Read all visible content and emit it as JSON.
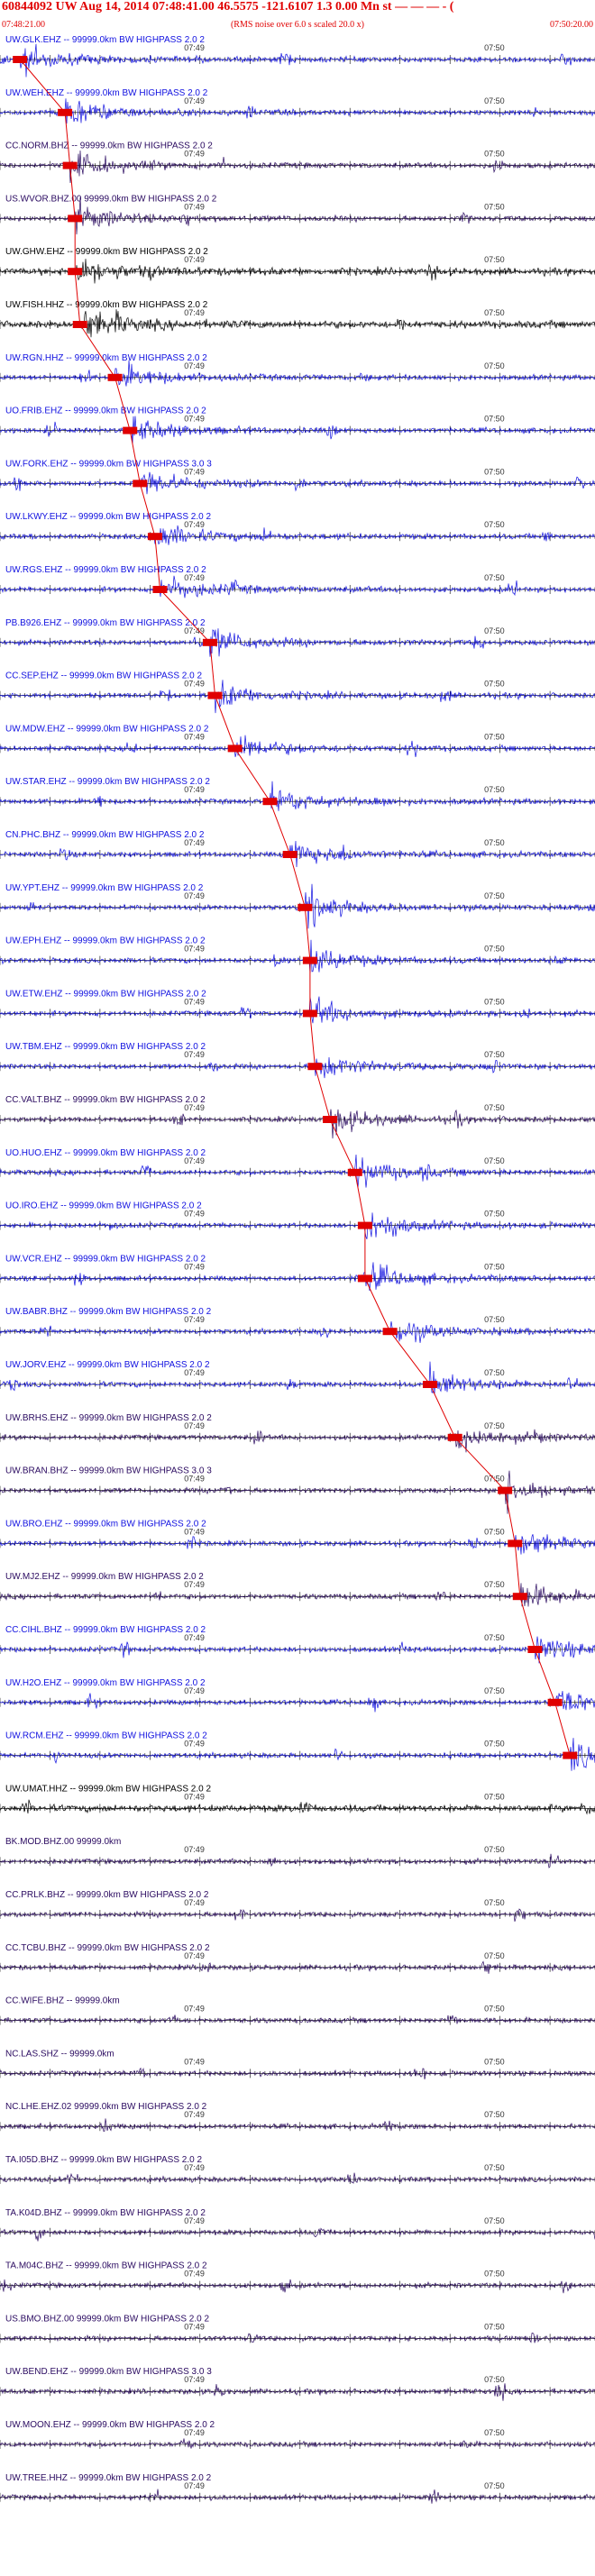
{
  "header": {
    "title": "60844092 UW Aug 14, 2014 07:48:41.00   46.5575 -121.6107   1.3 0.00 Mn st — — — - (",
    "start_time": "07:48:21.00",
    "end_time": "07:50:20.00",
    "subtitle": "(RMS noise over 6.0 s scaled 20.0 x)"
  },
  "colors": {
    "header_red": "#e00000",
    "pick_red": "#e00000",
    "trace_blue": "#1010e0",
    "trace_dark": "#2a0a60",
    "trace_black": "#000000"
  },
  "chart_data": {
    "type": "line",
    "x_label_1": "07:49",
    "x_label_2": "07:50",
    "xlim_seconds": [
      0,
      119
    ],
    "traces": [
      {
        "label": "UW.GLK.EHZ -- 99999.0km BW  HIGHPASS  2.0  2",
        "pick_s": 4,
        "color": "blue"
      },
      {
        "label": "UW.WEH.EHZ -- 99999.0km BW  HIGHPASS  2.0  2",
        "pick_s": 13,
        "color": "blue"
      },
      {
        "label": "CC.NORM.BHZ -- 99999.0km BW  HIGHPASS  2.0  2",
        "pick_s": 14,
        "color": "dark"
      },
      {
        "label": "US.WVOR.BHZ.00 99999.0km BW  HIGHPASS  2.0  2",
        "pick_s": 15,
        "color": "dark"
      },
      {
        "label": "UW.GHW.EHZ -- 99999.0km BW  HIGHPASS  2.0  2",
        "pick_s": 15,
        "color": "black"
      },
      {
        "label": "UW.FISH.HHZ -- 99999.0km BW  HIGHPASS  2.0  2",
        "pick_s": 16,
        "color": "black"
      },
      {
        "label": "UW.RGN.HHZ -- 99999.0km BW  HIGHPASS  2.0  2",
        "pick_s": 23,
        "color": "blue"
      },
      {
        "label": "UO.FRIB.EHZ -- 99999.0km BW  HIGHPASS  2.0  2",
        "pick_s": 26,
        "color": "blue"
      },
      {
        "label": "UW.FORK.EHZ -- 99999.0km BW  HIGHPASS  3.0  3",
        "pick_s": 28,
        "color": "blue"
      },
      {
        "label": "UW.LKWY.EHZ -- 99999.0km BW  HIGHPASS  2.0  2",
        "pick_s": 31,
        "color": "blue"
      },
      {
        "label": "UW.RGS.EHZ -- 99999.0km BW  HIGHPASS  2.0  2",
        "pick_s": 32,
        "color": "blue"
      },
      {
        "label": "PB.B926.EHZ -- 99999.0km BW  HIGHPASS  2.0  2",
        "pick_s": 42,
        "color": "blue"
      },
      {
        "label": "CC.SEP.EHZ -- 99999.0km BW  HIGHPASS  2.0  2",
        "pick_s": 43,
        "color": "blue"
      },
      {
        "label": "UW.MDW.EHZ -- 99999.0km BW  HIGHPASS  2.0  2",
        "pick_s": 47,
        "color": "blue"
      },
      {
        "label": "UW.STAR.EHZ -- 99999.0km BW  HIGHPASS  2.0  2",
        "pick_s": 54,
        "color": "blue"
      },
      {
        "label": "CN.PHC.BHZ -- 99999.0km BW  HIGHPASS  2.0  2",
        "pick_s": 58,
        "color": "blue"
      },
      {
        "label": "UW.YPT.EHZ -- 99999.0km BW  HIGHPASS  2.0  2",
        "pick_s": 61,
        "color": "blue"
      },
      {
        "label": "UW.EPH.EHZ -- 99999.0km BW  HIGHPASS  2.0  2",
        "pick_s": 62,
        "color": "blue"
      },
      {
        "label": "UW.ETW.EHZ -- 99999.0km BW  HIGHPASS  2.0  2",
        "pick_s": 62,
        "color": "blue"
      },
      {
        "label": "UW.TBM.EHZ -- 99999.0km BW  HIGHPASS  2.0  2",
        "pick_s": 63,
        "color": "blue"
      },
      {
        "label": "CC.VALT.BHZ -- 99999.0km BW  HIGHPASS  2.0  2",
        "pick_s": 66,
        "color": "dark"
      },
      {
        "label": "UO.HUO.EHZ -- 99999.0km BW  HIGHPASS  2.0  2",
        "pick_s": 71,
        "color": "blue"
      },
      {
        "label": "UO.IRO.EHZ -- 99999.0km BW  HIGHPASS  2.0  2",
        "pick_s": 73,
        "color": "blue"
      },
      {
        "label": "UW.VCR.EHZ -- 99999.0km BW  HIGHPASS  2.0  2",
        "pick_s": 73,
        "color": "blue"
      },
      {
        "label": "UW.BABR.BHZ -- 99999.0km BW  HIGHPASS  2.0  2",
        "pick_s": 78,
        "color": "blue"
      },
      {
        "label": "UW.JORV.EHZ -- 99999.0km BW  HIGHPASS  2.0  2",
        "pick_s": 86,
        "color": "blue"
      },
      {
        "label": "UW.BRHS.EHZ -- 99999.0km BW  HIGHPASS  2.0  2",
        "pick_s": 91,
        "color": "dark"
      },
      {
        "label": "UW.BRAN.BHZ -- 99999.0km BW  HIGHPASS  3.0  3",
        "pick_s": 101,
        "color": "dark"
      },
      {
        "label": "UW.BRO.EHZ -- 99999.0km BW  HIGHPASS  2.0  2",
        "pick_s": 103,
        "color": "blue"
      },
      {
        "label": "UW.MJ2.EHZ -- 99999.0km BW  HIGHPASS  2.0  2",
        "pick_s": 104,
        "color": "dark"
      },
      {
        "label": "CC.CIHL.BHZ -- 99999.0km BW  HIGHPASS  2.0  2",
        "pick_s": 107,
        "color": "blue"
      },
      {
        "label": "UW.H2O.EHZ -- 99999.0km BW  HIGHPASS  2.0  2",
        "pick_s": 111,
        "color": "blue"
      },
      {
        "label": "UW.RCM.EHZ -- 99999.0km BW  HIGHPASS  2.0  2",
        "pick_s": 114,
        "color": "blue"
      },
      {
        "label": "UW.UMAT.HHZ -- 99999.0km BW  HIGHPASS  2.0  2",
        "pick_s": null,
        "color": "black"
      },
      {
        "label": "BK.MOD.BHZ.00 99999.0km",
        "pick_s": null,
        "color": "dark"
      },
      {
        "label": "CC.PRLK.BHZ -- 99999.0km BW  HIGHPASS  2.0  2",
        "pick_s": null,
        "color": "dark"
      },
      {
        "label": "CC.TCBU.BHZ -- 99999.0km BW  HIGHPASS  2.0  2",
        "pick_s": null,
        "color": "dark"
      },
      {
        "label": "CC.WIFE.BHZ -- 99999.0km",
        "pick_s": null,
        "color": "dark"
      },
      {
        "label": "NC.LAS.SHZ -- 99999.0km",
        "pick_s": null,
        "color": "dark"
      },
      {
        "label": "NC.LHE.EHZ.02 99999.0km BW  HIGHPASS  2.0  2",
        "pick_s": null,
        "color": "dark"
      },
      {
        "label": "TA.I05D.BHZ -- 99999.0km BW  HIGHPASS  2.0  2",
        "pick_s": null,
        "color": "dark"
      },
      {
        "label": "TA.K04D.BHZ -- 99999.0km BW  HIGHPASS  2.0  2",
        "pick_s": null,
        "color": "dark"
      },
      {
        "label": "TA.M04C.BHZ -- 99999.0km BW  HIGHPASS  2.0  2",
        "pick_s": null,
        "color": "dark"
      },
      {
        "label": "US.BMO.BHZ.00 99999.0km BW  HIGHPASS  2.0  2",
        "pick_s": null,
        "color": "dark"
      },
      {
        "label": "UW.BEND.EHZ -- 99999.0km BW  HIGHPASS  3.0  3",
        "pick_s": null,
        "color": "dark"
      },
      {
        "label": "UW.MOON.EHZ -- 99999.0km BW  HIGHPASS  2.0  2",
        "pick_s": null,
        "color": "dark"
      },
      {
        "label": "UW.TREE.HHZ -- 99999.0km BW  HIGHPASS  2.0  2",
        "pick_s": null,
        "color": "dark"
      }
    ]
  }
}
